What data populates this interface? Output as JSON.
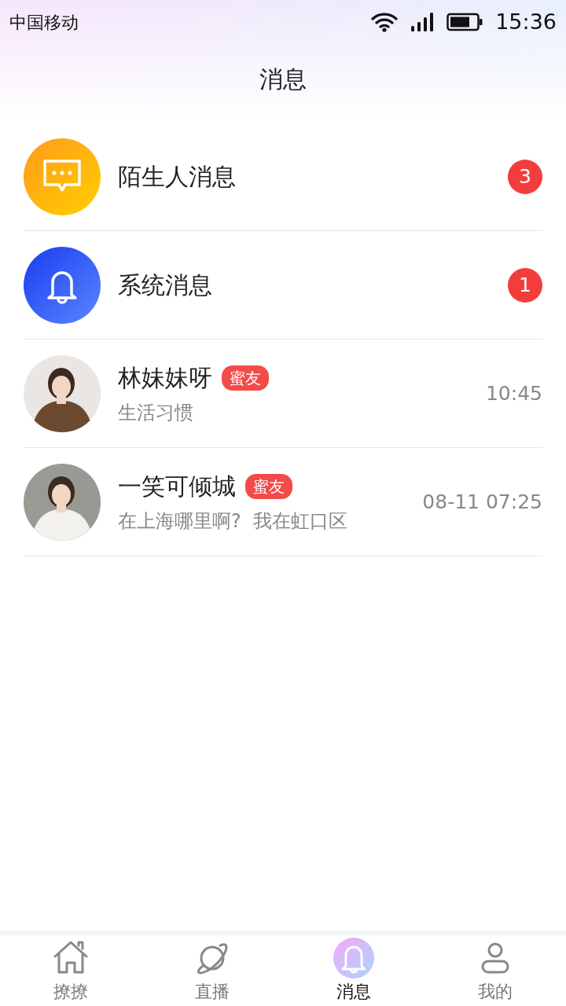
{
  "status_bar": {
    "carrier": "中国移动",
    "time": "15:36"
  },
  "header": {
    "title": "消息"
  },
  "conversations": [
    {
      "kind": "stranger",
      "title": "陌生人消息",
      "unread": "3"
    },
    {
      "kind": "system",
      "title": "系统消息",
      "unread": "1"
    },
    {
      "kind": "chat",
      "name": "林妹妹呀",
      "tag": "蜜友",
      "preview": "生活习惯",
      "time": "10:45"
    },
    {
      "kind": "chat",
      "name": "一笑可倾城",
      "tag": "蜜友",
      "preview": "在上海哪里啊?  我在虹口区",
      "time": "08-11 07:25"
    }
  ],
  "tabs": [
    {
      "label": "撩撩",
      "selected": false
    },
    {
      "label": "直播",
      "selected": false
    },
    {
      "label": "消息",
      "selected": true
    },
    {
      "label": "我的",
      "selected": false
    }
  ]
}
